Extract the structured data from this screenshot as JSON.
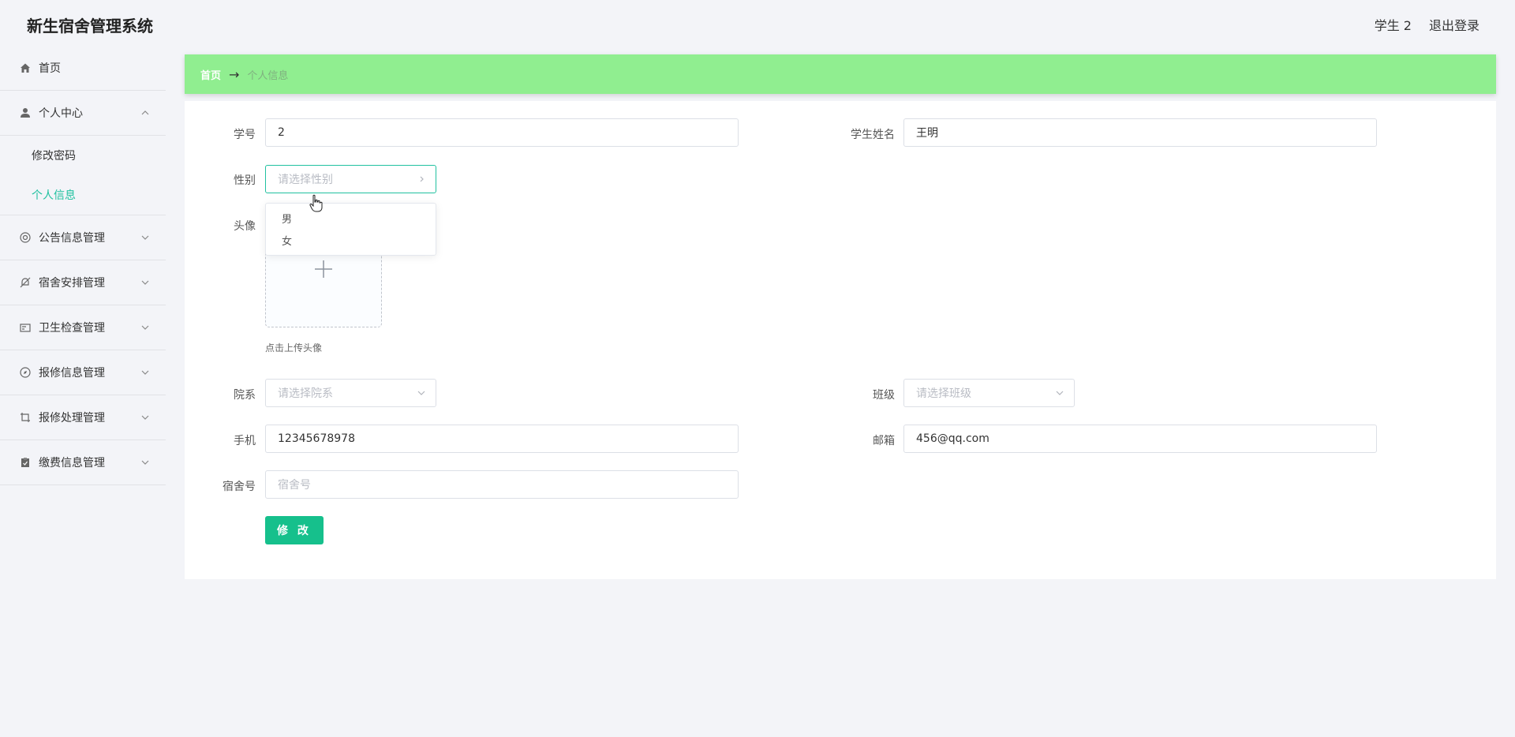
{
  "app": {
    "title": "新生宿舍管理系统",
    "user_label": "学生 2",
    "logout_label": "退出登录"
  },
  "sidebar": {
    "items": [
      {
        "label": "首页",
        "icon": "home-icon"
      },
      {
        "label": "个人中心",
        "icon": "user-icon",
        "expanded": true,
        "children": [
          {
            "label": "修改密码"
          },
          {
            "label": "个人信息",
            "active": true
          }
        ]
      },
      {
        "label": "公告信息管理",
        "icon": "lifebuoy-icon"
      },
      {
        "label": "宿舍安排管理",
        "icon": "bell-off-icon"
      },
      {
        "label": "卫生检查管理",
        "icon": "id-card-icon"
      },
      {
        "label": "报修信息管理",
        "icon": "compass-icon"
      },
      {
        "label": "报修处理管理",
        "icon": "crop-icon"
      },
      {
        "label": "缴费信息管理",
        "icon": "clipboard-icon"
      }
    ]
  },
  "breadcrumb": {
    "home": "首页",
    "separator": "→",
    "current": "个人信息"
  },
  "form": {
    "student_id": {
      "label": "学号",
      "value": "2"
    },
    "student_name": {
      "label": "学生姓名",
      "value": "王明"
    },
    "gender": {
      "label": "性别",
      "placeholder": "请选择性别",
      "options": [
        "男",
        "女"
      ]
    },
    "avatar": {
      "label": "头像",
      "hint": "点击上传头像"
    },
    "department": {
      "label": "院系",
      "placeholder": "请选择院系"
    },
    "class": {
      "label": "班级",
      "placeholder": "请选择班级"
    },
    "phone": {
      "label": "手机",
      "value": "12345678978"
    },
    "email": {
      "label": "邮箱",
      "value": "456@qq.com"
    },
    "dorm": {
      "label": "宿舍号",
      "placeholder": "宿舍号"
    },
    "submit_label": "修 改"
  },
  "colors": {
    "accent": "#21c1a0",
    "breadcrumb_bg": "#90ee90",
    "button": "#16c08c"
  }
}
